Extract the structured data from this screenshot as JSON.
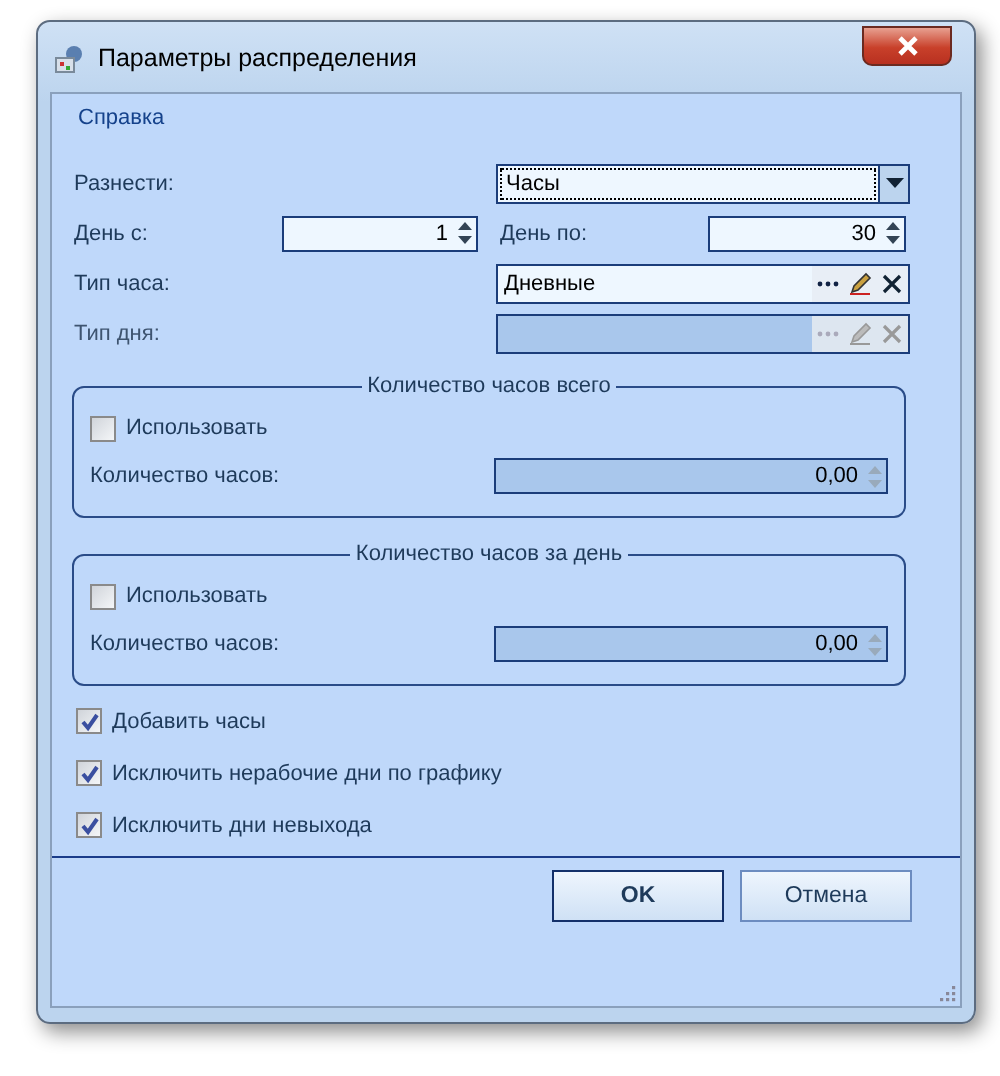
{
  "window": {
    "title": "Параметры распределения"
  },
  "menu": [
    "Справка"
  ],
  "spread": {
    "label": "Разнести:",
    "value": "Часы"
  },
  "day_from": {
    "label": "День с:",
    "value": "1"
  },
  "day_to": {
    "label": "День по:",
    "value": "30"
  },
  "lookups": [
    {
      "label": "Тип часа:",
      "value": "Дневные",
      "disabled": false
    },
    {
      "label": "Тип дня:",
      "disabled": true
    }
  ],
  "groups": [
    {
      "title": "Количество часов всего",
      "use": {
        "label": "Использовать",
        "checked": false
      },
      "field": {
        "label": "Количество часов:",
        "value": "0,00",
        "disabled": true
      }
    },
    {
      "title": "Количество часов за день",
      "use": {
        "label": "Использовать",
        "checked": false
      },
      "field": {
        "label": "Количество часов:",
        "value": "0,00",
        "disabled": true
      }
    }
  ],
  "options": [
    {
      "label": "Добавить часы",
      "checked": true
    },
    {
      "label": "Исключить нерабочие дни по графику",
      "checked": true
    },
    {
      "label": "Исключить дни невыхода",
      "checked": true
    }
  ],
  "buttons": [
    {
      "label": "OK",
      "default": true
    },
    {
      "label": "Отмена",
      "default": false
    }
  ]
}
